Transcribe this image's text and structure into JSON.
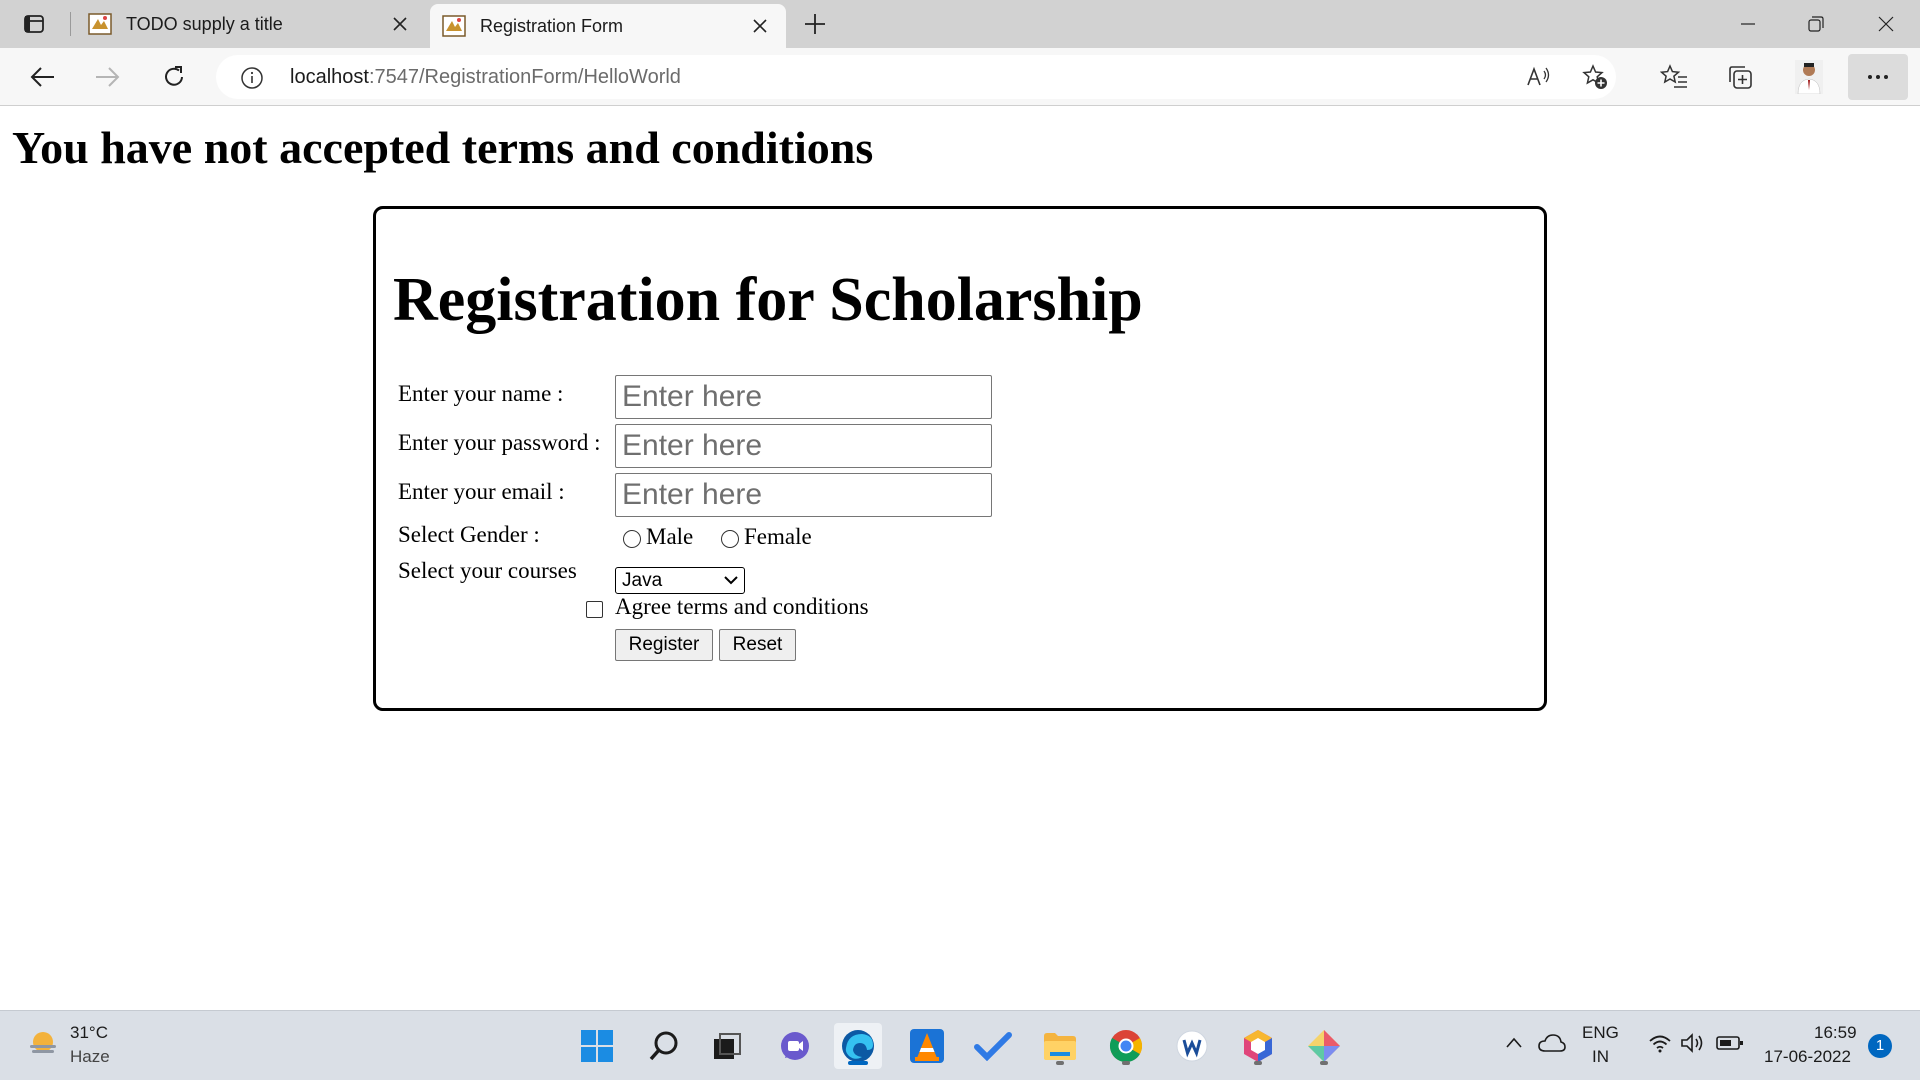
{
  "browser": {
    "tabs": [
      {
        "title": "TODO supply a title",
        "active": false
      },
      {
        "title": "Registration Form",
        "active": true
      }
    ],
    "address": {
      "host": "localhost",
      "path": ":7547/RegistrationForm/HelloWorld"
    }
  },
  "page": {
    "alert_heading": "You have not accepted terms and conditions",
    "form": {
      "title": "Registration for Scholarship",
      "name_label": "Enter your name :",
      "name_placeholder": "Enter here",
      "password_label": "Enter your password :",
      "password_placeholder": "Enter here",
      "email_label": "Enter your email :",
      "email_placeholder": "Enter here",
      "gender_label": "Select Gender :",
      "gender_options": [
        "Male",
        "Female"
      ],
      "courses_label": "Select your courses",
      "courses_selected": "Java",
      "agree_label": "Agree terms and conditions",
      "register_label": "Register",
      "reset_label": "Reset"
    }
  },
  "taskbar": {
    "weather_temp": "31°C",
    "weather_condition": "Haze",
    "lang_line1": "ENG",
    "lang_line2": "IN",
    "time": "16:59",
    "date": "17-06-2022",
    "notification_count": "1"
  },
  "colors": {
    "accent": "#0067c0",
    "edge_blue": "#0c59a4"
  }
}
